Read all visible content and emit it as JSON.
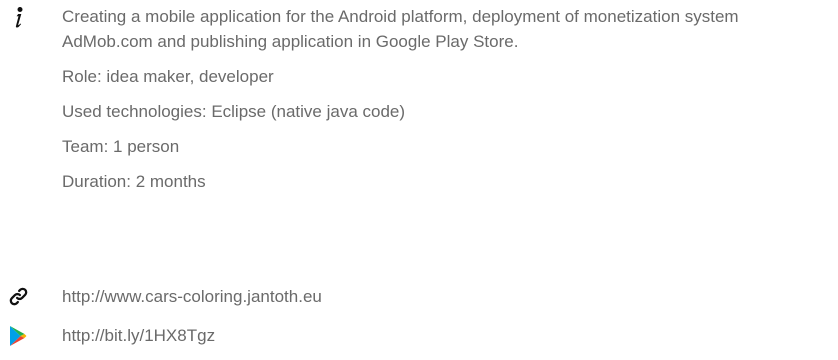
{
  "description": "Creating a mobile application for the Android platform, deployment of monetization system AdMob.com and publishing application in Google Play Store.",
  "details": {
    "role": "Role: idea maker, developer",
    "technologies": "Used technologies: Eclipse (native java code)",
    "team": "Team: 1 person",
    "duration": "Duration: 2 months"
  },
  "links": {
    "website": "http://www.cars-coloring.jantoth.eu",
    "store": "http://bit.ly/1HX8Tgz"
  },
  "icons": {
    "info": "info-icon",
    "link": "link-icon",
    "play": "google-play-icon"
  },
  "colors": {
    "text": "#6a6a6a",
    "play_blue": "#00a0e8",
    "play_green": "#22b24c",
    "play_yellow": "#f6b300",
    "play_red": "#ea4335"
  }
}
